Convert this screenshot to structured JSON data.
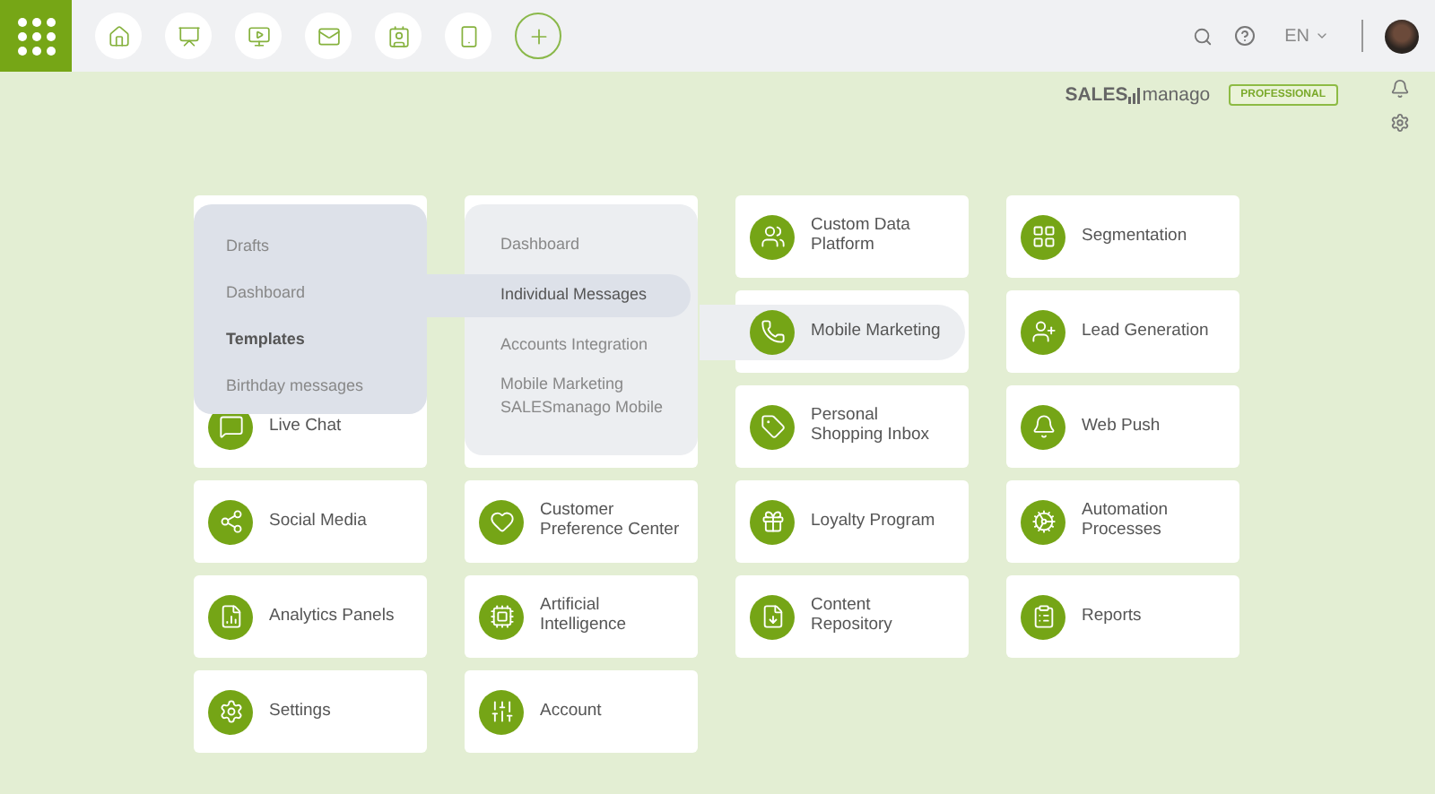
{
  "top_bar": {
    "language": "EN"
  },
  "header": {
    "brand_left": "SALES",
    "brand_right": "manago",
    "plan_badge": "PROFESSIONAL"
  },
  "columns": [
    {
      "tiles": [
        {
          "kind": "covered"
        },
        {
          "kind": "covered"
        },
        {
          "kind": "app",
          "label": "Live Chat",
          "expanded": false
        },
        {
          "kind": "app",
          "label": "Social Media",
          "expanded": false
        },
        {
          "kind": "app",
          "label": "Analytics Panels",
          "expanded": false
        },
        {
          "kind": "app",
          "label": "Settings",
          "expanded": false
        }
      ]
    },
    {
      "tiles": [
        {
          "kind": "covered"
        },
        {
          "kind": "covered"
        },
        {
          "kind": "covered"
        },
        {
          "kind": "app",
          "label": "Customer Preference Center",
          "expanded": false
        },
        {
          "kind": "app",
          "label": "Artificial Intelligence",
          "expanded": false
        },
        {
          "kind": "app",
          "label": "Account",
          "expanded": false
        }
      ]
    },
    {
      "tiles": [
        {
          "kind": "app",
          "label": "Custom Data Platform",
          "expanded": false
        },
        {
          "kind": "app",
          "label": "Mobile Marketing",
          "expanded": true
        },
        {
          "kind": "app",
          "label": "Personal Shopping Inbox",
          "expanded": false
        },
        {
          "kind": "app",
          "label": "Loyalty Program",
          "expanded": false
        },
        {
          "kind": "app",
          "label": "Content Repository",
          "expanded": false
        }
      ]
    },
    {
      "tiles": [
        {
          "kind": "app",
          "label": "Segmentation",
          "expanded": false
        },
        {
          "kind": "app",
          "label": "Lead Generation",
          "expanded": false
        },
        {
          "kind": "app",
          "label": "Web Push",
          "expanded": false
        },
        {
          "kind": "app",
          "label": "Automation Processes",
          "expanded": false
        },
        {
          "kind": "app",
          "label": "Reports",
          "expanded": false
        }
      ]
    }
  ],
  "submenu": {
    "items": [
      {
        "label": "Dashboard",
        "selected": false
      },
      {
        "label": "Individual Messages",
        "selected": true
      },
      {
        "label": "Accounts Integration",
        "selected": false
      },
      {
        "label": "Mobile Marketing SALESmanago Mobile",
        "selected": false
      }
    ]
  },
  "subsubmenu": {
    "items": [
      {
        "label": "Drafts",
        "selected": false
      },
      {
        "label": "Dashboard",
        "selected": false
      },
      {
        "label": "Templates",
        "selected": true
      },
      {
        "label": "Birthday messages",
        "selected": false
      }
    ]
  }
}
